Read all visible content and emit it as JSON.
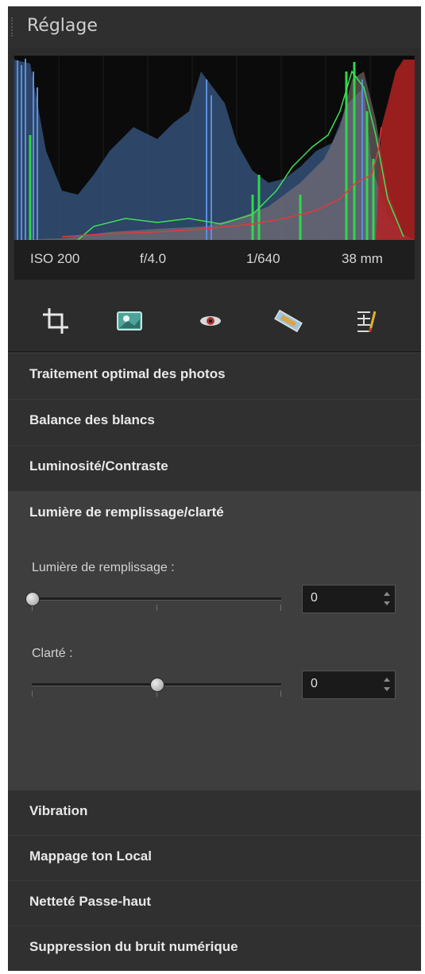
{
  "panel": {
    "title": "Réglage"
  },
  "exif": {
    "iso": "ISO 200",
    "aperture": "f/4.0",
    "shutter": "1/640",
    "focal": "38 mm"
  },
  "tools": [
    {
      "icon": "crop-icon"
    },
    {
      "icon": "picture-icon"
    },
    {
      "icon": "eye-icon"
    },
    {
      "icon": "straighten-icon"
    },
    {
      "icon": "adjust-levels-icon"
    }
  ],
  "sections_top": [
    {
      "label": "Traitement optimal des photos"
    },
    {
      "label": "Balance des blancs"
    },
    {
      "label": "Luminosité/Contraste"
    }
  ],
  "expanded": {
    "title": "Lumière de remplissage/clarté",
    "fill_light": {
      "label": "Lumière de remplissage :",
      "value": "0",
      "position": 0.0
    },
    "clarity": {
      "label": "Clarté :",
      "value": "0",
      "position": 0.5
    }
  },
  "sections_bottom": [
    {
      "label": "Vibration"
    },
    {
      "label": "Mappage ton Local"
    },
    {
      "label": "Netteté Passe-haut"
    },
    {
      "label": "Suppression du bruit numérique"
    }
  ],
  "colors": {
    "panel": "#2c2c2c",
    "expanded": "#3e3e3e",
    "histogram_bg": "#0b0b0b"
  }
}
